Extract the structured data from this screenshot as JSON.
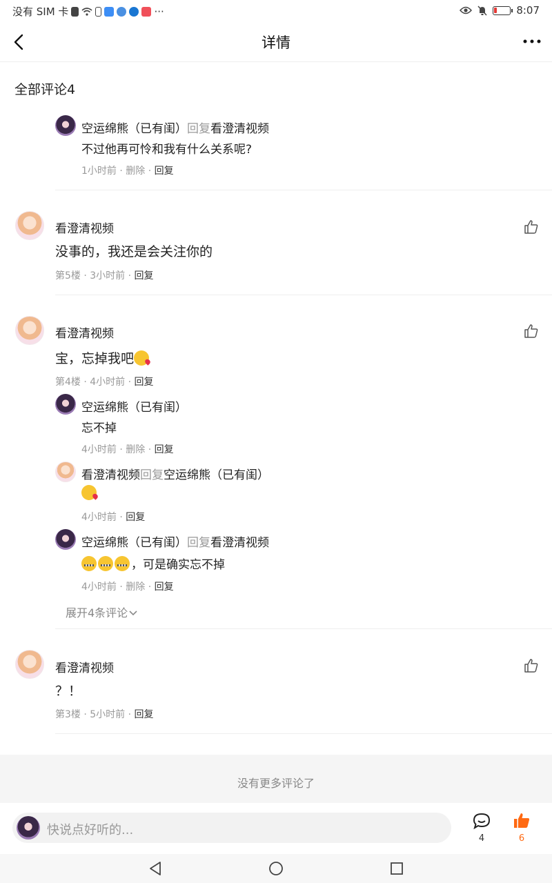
{
  "status_bar": {
    "carrier": "没有 SIM 卡",
    "more": "···",
    "time": "8:07"
  },
  "header": {
    "title": "详情"
  },
  "comments_header": "全部评论4",
  "reply_label": "回复",
  "top_reply": {
    "author": "空运绵熊（已有闺）",
    "reply_to": "看澄清视频",
    "text": "不过他再可怜和我有什么关系呢?",
    "time": "1小时前 ·",
    "delete": "删除 ·",
    "reply": "回复"
  },
  "comments": [
    {
      "author": "看澄清视频",
      "text": "没事的，我还是会关注你的",
      "floor_time": "第5楼 · 3小时前 ·",
      "reply": "回复"
    },
    {
      "author": "看澄清视频",
      "text": "宝，忘掉我吧",
      "floor_time": "第4楼 · 4小时前 ·",
      "reply": "回复",
      "replies": [
        {
          "author": "空运绵熊（已有闺）",
          "text": "忘不掉",
          "time": "4小时前 ·",
          "delete": "删除 ·",
          "reply": "回复"
        },
        {
          "author": "看澄清视频",
          "reply_to": "空运绵熊（已有闺）",
          "emoji": "kiss",
          "time": "4小时前 ·",
          "reply": "回复"
        },
        {
          "author": "空运绵熊（已有闺）",
          "reply_to": "看澄清视频",
          "text": "，可是确实忘不掉",
          "emoji": "zipper-mouth x3",
          "time": "4小时前 ·",
          "delete": "删除 ·",
          "reply": "回复"
        }
      ],
      "expand": "展开4条评论"
    },
    {
      "author": "看澄清视频",
      "text": "？！",
      "floor_time": "第3楼 · 5小时前 ·",
      "reply": "回复"
    }
  ],
  "no_more": "没有更多评论了",
  "input_bar": {
    "placeholder": "快说点好听的...",
    "comment_count": "4",
    "like_count": "6"
  },
  "colors": {
    "accent": "#ff6a13",
    "muted": "#999999"
  }
}
